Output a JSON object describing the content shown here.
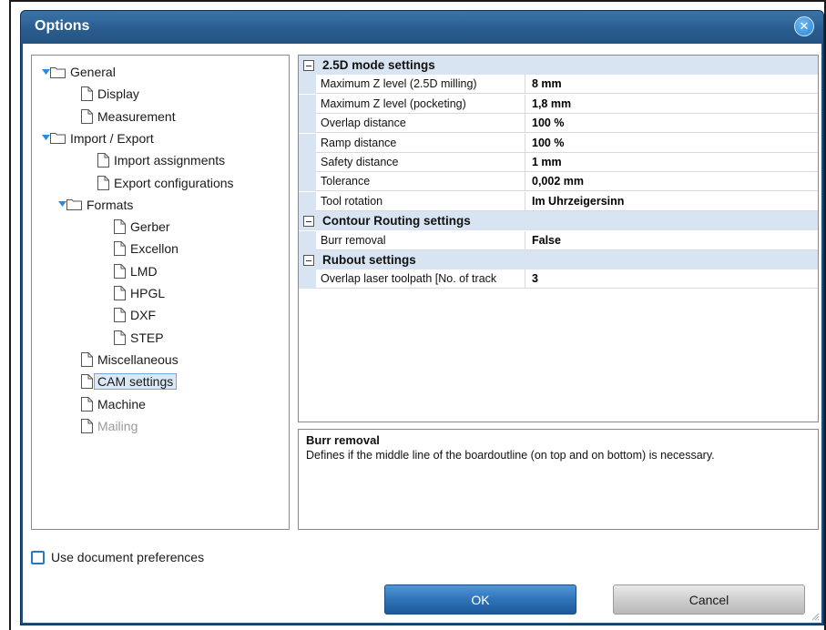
{
  "window": {
    "title": "Options",
    "close_label": "✕"
  },
  "tree": {
    "items": [
      {
        "label": "General",
        "kind": "folder",
        "expanded": true,
        "level": 0
      },
      {
        "label": "Display",
        "kind": "doc",
        "level": 1
      },
      {
        "label": "Measurement",
        "kind": "doc",
        "level": 1
      },
      {
        "label": "Import / Export",
        "kind": "folder",
        "expanded": true,
        "level": 0
      },
      {
        "label": "Import assignments",
        "kind": "doc",
        "level": 2
      },
      {
        "label": "Export configurations",
        "kind": "doc",
        "level": 2
      },
      {
        "label": "Formats",
        "kind": "folder",
        "expanded": true,
        "level": 1
      },
      {
        "label": "Gerber",
        "kind": "doc",
        "level": 3
      },
      {
        "label": "Excellon",
        "kind": "doc",
        "level": 3
      },
      {
        "label": "LMD",
        "kind": "doc",
        "level": 3
      },
      {
        "label": "HPGL",
        "kind": "doc",
        "level": 3
      },
      {
        "label": "DXF",
        "kind": "doc",
        "level": 3
      },
      {
        "label": "STEP",
        "kind": "doc",
        "level": 3
      },
      {
        "label": "Miscellaneous",
        "kind": "doc",
        "level": 1
      },
      {
        "label": "CAM settings",
        "kind": "doc",
        "level": 1,
        "selected": true
      },
      {
        "label": "Machine",
        "kind": "doc",
        "level": 1
      },
      {
        "label": "Mailing",
        "kind": "doc",
        "level": 1,
        "disabled": true
      }
    ]
  },
  "grid": {
    "categories": [
      {
        "name": "2.5D mode settings",
        "props": [
          {
            "name": "Maximum Z level (2.5D milling)",
            "value": "8 mm"
          },
          {
            "name": "Maximum Z level (pocketing)",
            "value": "1,8 mm"
          },
          {
            "name": "Overlap distance",
            "value": "100 %"
          },
          {
            "name": "Ramp distance",
            "value": "100 %"
          },
          {
            "name": "Safety distance",
            "value": "1 mm"
          },
          {
            "name": "Tolerance",
            "value": "0,002 mm"
          },
          {
            "name": "Tool rotation",
            "value": "Im Uhrzeigersinn"
          }
        ]
      },
      {
        "name": "Contour Routing settings",
        "props": [
          {
            "name": "Burr removal",
            "value": "False"
          }
        ]
      },
      {
        "name": "Rubout settings",
        "props": [
          {
            "name": "Overlap laser toolpath [No. of track",
            "value": "3"
          }
        ]
      }
    ]
  },
  "description": {
    "title": "Burr removal",
    "text": "Defines if the middle line of the boardoutline (on top and on bottom) is necessary."
  },
  "footer": {
    "checkbox_label": "Use document preferences",
    "checkbox_checked": false,
    "ok_label": "OK",
    "cancel_label": "Cancel"
  },
  "colors": {
    "title_bar": "#2a5d90",
    "category_band": "#d8e4f2",
    "ok_button": "#2f74b8",
    "selected_item": "#dbe9f7",
    "tree_arrow": "#2b8ae0"
  }
}
